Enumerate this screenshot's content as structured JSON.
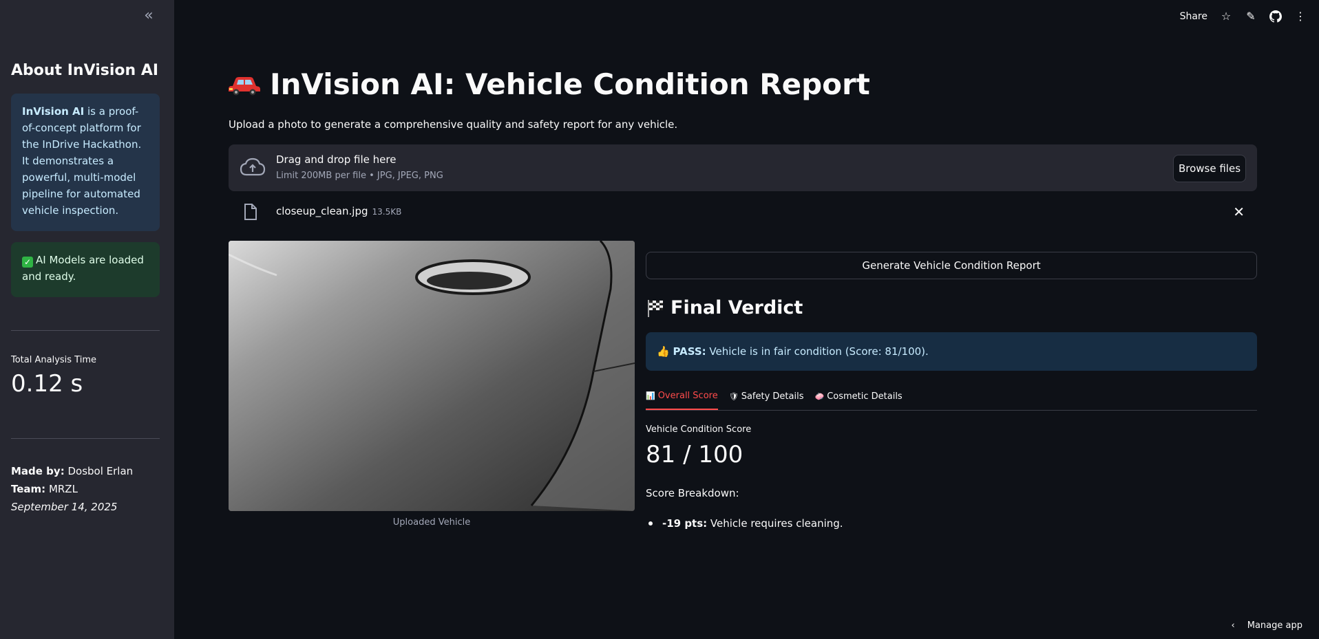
{
  "sidebar": {
    "collapse_icon": "chevrons-left-icon",
    "title": "About InVision AI",
    "info": {
      "bold": "InVision AI",
      "text": " is a proof-of-concept platform for the InDrive Hackathon. It demonstrates a powerful, multi-model pipeline for automated vehicle inspection."
    },
    "status": "AI Models are loaded and ready.",
    "metric": {
      "label": "Total Analysis Time",
      "value": "0.12 s"
    },
    "credits": {
      "made_by_label": "Made by:",
      "made_by": " Dosbol Erlan",
      "team_label": "Team:",
      "team": " MRZL",
      "date": "September 14, 2025"
    }
  },
  "topbar": {
    "share": "Share"
  },
  "main": {
    "title": "InVision AI: Vehicle Condition Report",
    "subtitle": "Upload a photo to generate a comprehensive quality and safety report for any vehicle.",
    "uploader": {
      "drag": "Drag and drop file here",
      "limit": "Limit 200MB per file • JPG, JPEG, PNG",
      "browse": "Browse files"
    },
    "file": {
      "name": "closeup_clean.jpg",
      "size": "13.5KB"
    },
    "image_caption": "Uploaded Vehicle",
    "generate_button": "Generate Vehicle Condition Report",
    "verdict": {
      "title": "Final Verdict",
      "label": "PASS:",
      "text": " Vehicle is in fair condition (Score: 81/100)."
    },
    "tabs": [
      "Overall Score",
      "Safety Details",
      "Cosmetic Details"
    ],
    "score": {
      "label": "Vehicle Condition Score",
      "value": "81 / 100"
    },
    "breakdown_title": "Score Breakdown:",
    "breakdown_items": [
      {
        "pts": "-19 pts:",
        "text": " Vehicle requires cleaning."
      }
    ]
  },
  "footer": {
    "manage": "Manage app"
  }
}
